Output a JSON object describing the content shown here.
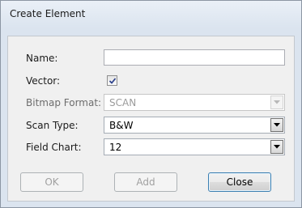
{
  "window": {
    "title": "Create Element"
  },
  "form": {
    "name_label": "Name:",
    "name_value": "",
    "vector_label": "Vector:",
    "vector_checked": true,
    "bitmap_format_label": "Bitmap Format:",
    "bitmap_format_value": "SCAN",
    "scan_type_label": "Scan Type:",
    "scan_type_value": "B&W",
    "field_chart_label": "Field Chart:",
    "field_chart_value": "12"
  },
  "buttons": {
    "ok_label": "OK",
    "add_label": "Add",
    "close_label": "Close"
  }
}
